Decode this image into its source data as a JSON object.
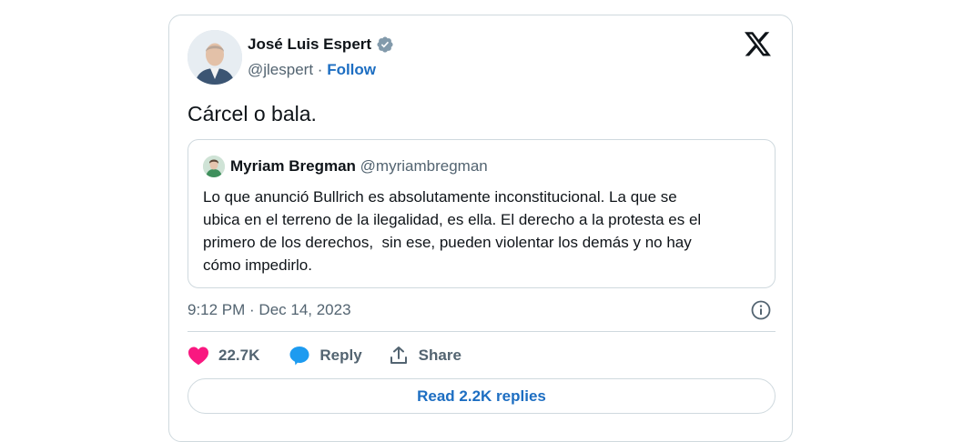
{
  "author": {
    "name": "José Luis Espert",
    "handle": "@jlespert",
    "separator": "·",
    "follow_label": "Follow",
    "verified_color": "#829aab"
  },
  "tweet": {
    "text": "Cárcel o bala.",
    "timestamp": "9:12 PM · Dec 14, 2023"
  },
  "quoted": {
    "name": "Myriam Bregman",
    "handle": "@myriambregman",
    "text": "Lo que anunció Bullrich es absolutamente inconstitucional. La que se\nubica en el terreno de la ilegalidad, es ella. El derecho a la protesta es el\nprimero de los derechos,  sin ese, pueden violentar los demás y no hay\ncómo impedirlo."
  },
  "actions": {
    "likes": "22.7K",
    "reply_label": "Reply",
    "share_label": "Share",
    "like_color": "#f91880",
    "reply_color": "#1d9bf0"
  },
  "read_replies_label": "Read 2.2K replies",
  "accent_color": "#1d6ec2"
}
